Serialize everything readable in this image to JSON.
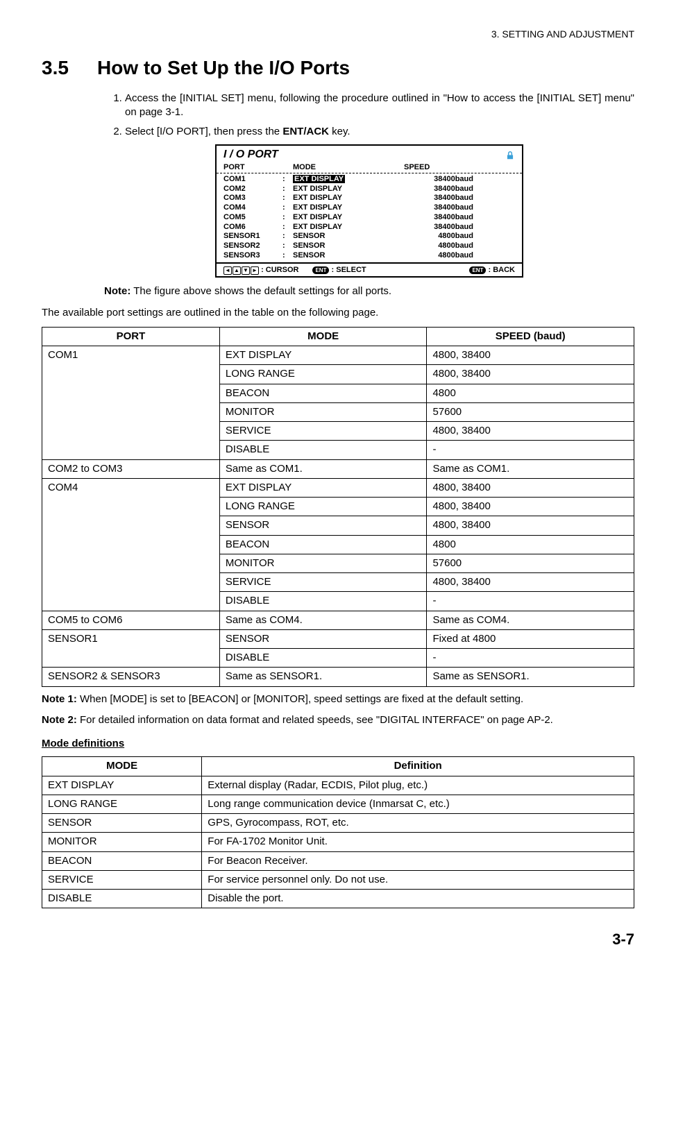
{
  "header": {
    "chapter": "3.  SETTING AND ADJUSTMENT"
  },
  "section": {
    "number": "3.5",
    "title": "How to Set Up the I/O Ports"
  },
  "steps": {
    "s1": "Access the [INITIAL SET] menu, following the procedure outlined in \"How to access the [INITIAL SET] menu\" on page 3-1.",
    "s2_a": "Select [I/O PORT], then press the ",
    "s2_b": "ENT/ACK",
    "s2_c": " key."
  },
  "screen": {
    "title": "I / O PORT",
    "headers": {
      "port": "PORT",
      "mode": "MODE",
      "speed": "SPEED"
    },
    "rows": [
      {
        "port": "COM1",
        "mode": "EXT DISPLAY",
        "speed": "38400baud",
        "selected": true
      },
      {
        "port": "COM2",
        "mode": "EXT DISPLAY",
        "speed": "38400baud"
      },
      {
        "port": "COM3",
        "mode": "EXT DISPLAY",
        "speed": "38400baud"
      },
      {
        "port": "COM4",
        "mode": "EXT DISPLAY",
        "speed": "38400baud"
      },
      {
        "port": "COM5",
        "mode": "EXT DISPLAY",
        "speed": "38400baud"
      },
      {
        "port": "COM6",
        "mode": "EXT DISPLAY",
        "speed": "38400baud"
      },
      {
        "port": "SENSOR1",
        "mode": "SENSOR",
        "speed": "4800baud"
      },
      {
        "port": "SENSOR2",
        "mode": "SENSOR",
        "speed": "4800baud"
      },
      {
        "port": "SENSOR3",
        "mode": "SENSOR",
        "speed": "4800baud"
      }
    ],
    "footer": {
      "cursor": ": CURSOR",
      "select": ": SELECT",
      "back": ": BACK",
      "ent": "ENT"
    }
  },
  "note_after_screen_b": "Note:",
  "note_after_screen": " The figure above shows the default settings for all ports.",
  "body_text": "The available port settings are outlined in the table on the following page.",
  "port_table": {
    "headers": {
      "port": "PORT",
      "mode": "MODE",
      "speed": "SPEED (baud)"
    },
    "rows": [
      {
        "port": "COM1",
        "port_span": 6,
        "mode": "EXT DISPLAY",
        "speed": "4800, 38400"
      },
      {
        "mode": "LONG RANGE",
        "speed": "4800, 38400"
      },
      {
        "mode": "BEACON",
        "speed": "4800"
      },
      {
        "mode": "MONITOR",
        "speed": "57600"
      },
      {
        "mode": "SERVICE",
        "speed": "4800, 38400"
      },
      {
        "mode": "DISABLE",
        "speed": "-"
      },
      {
        "port": "COM2 to COM3",
        "port_span": 1,
        "mode": "Same as COM1.",
        "speed": "Same as COM1."
      },
      {
        "port": "COM4",
        "port_span": 7,
        "mode": "EXT DISPLAY",
        "speed": "4800, 38400"
      },
      {
        "mode": "LONG RANGE",
        "speed": "4800, 38400"
      },
      {
        "mode": "SENSOR",
        "speed": "4800, 38400"
      },
      {
        "mode": "BEACON",
        "speed": "4800"
      },
      {
        "mode": "MONITOR",
        "speed": "57600"
      },
      {
        "mode": "SERVICE",
        "speed": "4800, 38400"
      },
      {
        "mode": "DISABLE",
        "speed": "-"
      },
      {
        "port": "COM5 to COM6",
        "port_span": 1,
        "mode": "Same as COM4.",
        "speed": "Same as COM4."
      },
      {
        "port": "SENSOR1",
        "port_span": 2,
        "mode": "SENSOR",
        "speed": "Fixed at 4800"
      },
      {
        "mode": "DISABLE",
        "speed": "-"
      },
      {
        "port": "SENSOR2 & SENSOR3",
        "port_span": 1,
        "mode": "Same as SENSOR1.",
        "speed": "Same as SENSOR1."
      }
    ]
  },
  "note1_b": "Note 1:",
  "note1": " When [MODE] is set to [BEACON] or [MONITOR], speed settings are fixed at the default setting.",
  "note2_b": "Note 2:",
  "note2": " For detailed information on data format and related speeds, see \"DIGITAL INTERFACE\" on page AP-2.",
  "mode_def_heading": "Mode definitions",
  "mode_table": {
    "headers": {
      "mode": "MODE",
      "def": "Definition"
    },
    "rows": [
      {
        "mode": "EXT DISPLAY",
        "def": "External display (Radar, ECDIS, Pilot plug, etc.)"
      },
      {
        "mode": "LONG RANGE",
        "def": "Long range communication device (Inmarsat C, etc.)"
      },
      {
        "mode": "SENSOR",
        "def": "GPS, Gyrocompass, ROT, etc."
      },
      {
        "mode": "MONITOR",
        "def": "For FA-1702 Monitor Unit."
      },
      {
        "mode": "BEACON",
        "def": "For Beacon Receiver."
      },
      {
        "mode": "SERVICE",
        "def": "For service personnel only. Do not use."
      },
      {
        "mode": "DISABLE",
        "def": "Disable the port."
      }
    ]
  },
  "page_number": "3-7"
}
